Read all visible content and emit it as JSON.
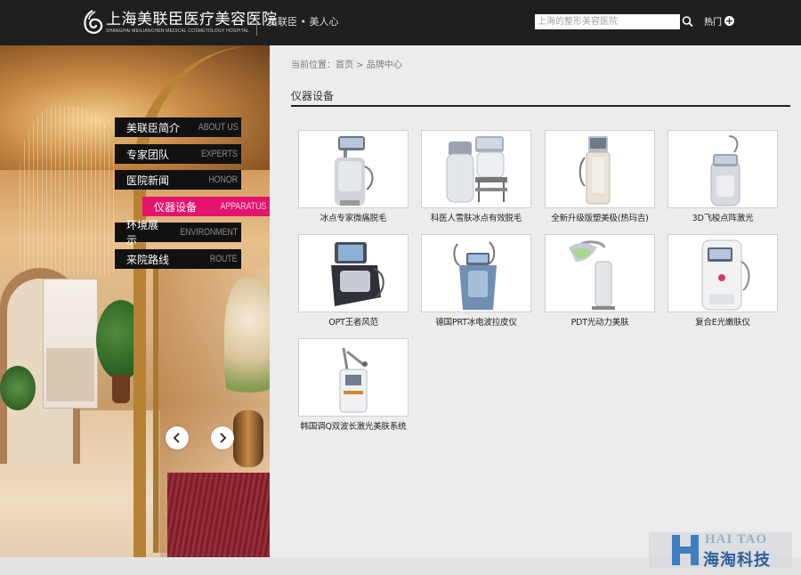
{
  "header": {
    "logo_cn": "上海美联臣医疗美容医院",
    "logo_en": "SHANGHAI MEILIANCHEN MEDICAL COSMETOLOGY HOSPITAL",
    "slogan": "美联臣 • 美人心",
    "search_placeholder": "上海的整形美容医院",
    "hot_label": "热门",
    "hot_icon": "plus-circle-icon",
    "search_icon": "magnifier-icon"
  },
  "menu": [
    {
      "cn": "美联臣简介",
      "en": "ABOUT US",
      "active": false
    },
    {
      "cn": "专家团队",
      "en": "EXPERTS",
      "active": false
    },
    {
      "cn": "医院新闻",
      "en": "HONOR",
      "active": false
    },
    {
      "cn": "仪器设备",
      "en": "APPARATUS",
      "active": true
    },
    {
      "cn": "环境展示",
      "en": "ENVIRONMENT",
      "active": false
    },
    {
      "cn": "来院路线",
      "en": "ROUTE",
      "active": false
    }
  ],
  "breadcrumb": {
    "prefix": "当前位置：",
    "home": "首页",
    "sep": " > ",
    "current": "品牌中心"
  },
  "section_title": "仪器设备",
  "products": [
    {
      "caption": "冰点专家微痛脱毛"
    },
    {
      "caption": "科医人雪肤冰点有效脱毛"
    },
    {
      "caption": "全新升级版塑美极(热玛吉)"
    },
    {
      "caption": "3D飞梭点阵激光"
    },
    {
      "caption": "OPT王者风范"
    },
    {
      "caption": "德国PRT冰电波拉皮仪"
    },
    {
      "caption": "PDT光动力美肤"
    },
    {
      "caption": "复合E光嫩肤仪"
    },
    {
      "caption": "韩国调Q双波长激光美肤系统"
    }
  ],
  "watermark": {
    "en": "HAI TAO",
    "cn": "海淘科技"
  },
  "colors": {
    "header_bg": "#1f1f1f",
    "accent": "#e3136e",
    "page_bg": "#ececec"
  }
}
